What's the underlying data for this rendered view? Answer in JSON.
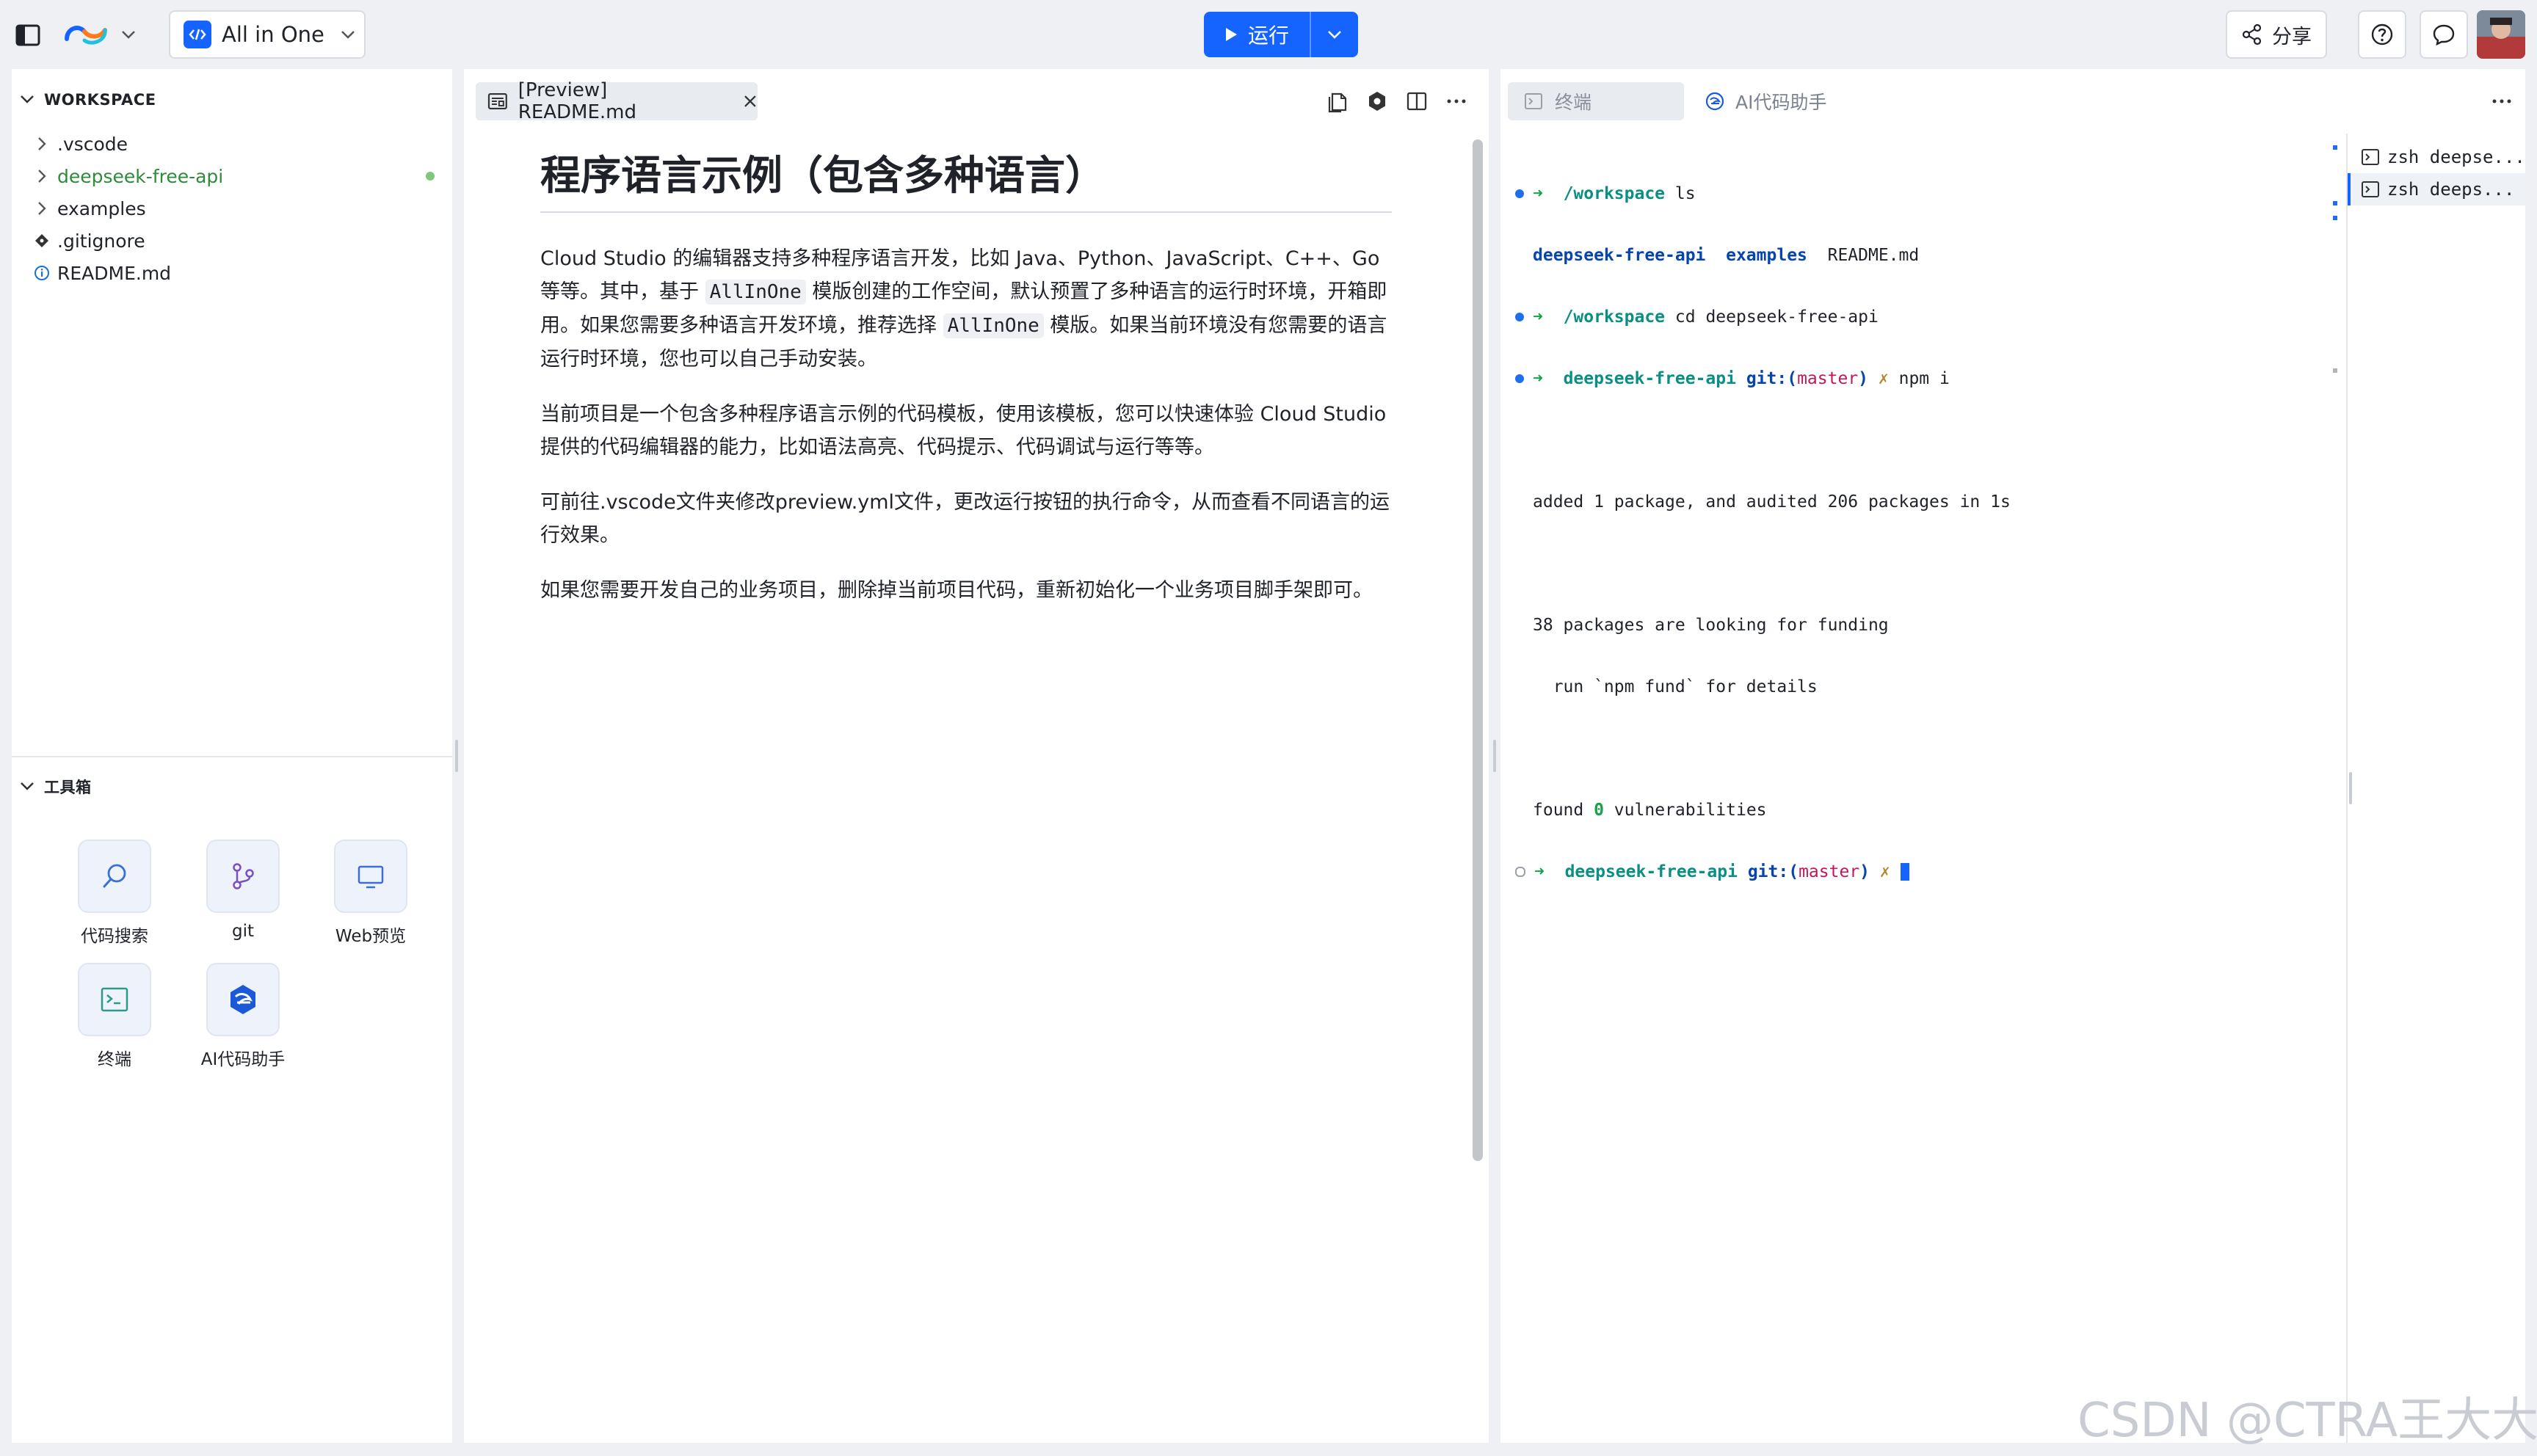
{
  "topbar": {
    "workspace_selector": "All in One",
    "run_label": "运行",
    "share_label": "分享"
  },
  "sidebar": {
    "workspace_title": "WORKSPACE",
    "items": [
      {
        "label": ".vscode",
        "type": "folder"
      },
      {
        "label": "deepseek-free-api",
        "type": "folder"
      },
      {
        "label": "examples",
        "type": "folder"
      },
      {
        "label": ".gitignore",
        "type": "file"
      },
      {
        "label": "README.md",
        "type": "file"
      }
    ],
    "toolbox_title": "工具箱",
    "tools": [
      {
        "label": "代码搜索",
        "icon": "search-icon"
      },
      {
        "label": "git",
        "icon": "git-branch-icon"
      },
      {
        "label": "Web预览",
        "icon": "monitor-icon"
      },
      {
        "label": "终端",
        "icon": "terminal-icon"
      },
      {
        "label": "AI代码助手",
        "icon": "ai-assistant-icon"
      }
    ]
  },
  "editor": {
    "tab_label": "[Preview] README.md",
    "heading": "程序语言示例（包含多种语言）",
    "p1_a": "Cloud Studio 的编辑器支持多种程序语言开发，比如 Java、Python、JavaScript、C++、Go 等等。其中，基于 ",
    "p1_code1": "AllInOne",
    "p1_b": " 模版创建的工作空间，默认预置了多种语言的运行时环境，开箱即用。如果您需要多种语言开发环境，推荐选择 ",
    "p1_code2": "AllInOne",
    "p1_c": " 模版。如果当前环境没有您需要的语言运行时环境，您也可以自己手动安装。",
    "p2": "当前项目是一个包含多种程序语言示例的代码模板，使用该模板，您可以快速体验 Cloud Studio 提供的代码编辑器的能力，比如语法高亮、代码提示、代码调试与运行等等。",
    "p3": "可前往.vscode文件夹修改preview.yml文件，更改运行按钮的执行命令，从而查看不同语言的运行效果。",
    "p4": "如果您需要开发自己的业务项目，删除掉当前项目代码，重新初始化一个业务项目脚手架即可。"
  },
  "terminal": {
    "tabs": [
      "终端",
      "AI代码助手"
    ],
    "l1_arrow": "➜",
    "l1_dir": "/workspace",
    "l1_cmd": "ls",
    "l2_a": "deepseek-free-api",
    "l2_b": "examples",
    "l2_c": "README.md",
    "l3_dir": "/workspace",
    "l3_cmd": "cd deepseek-free-api",
    "l4_dir": "deepseek-free-api",
    "l4_git": "git:(",
    "l4_branch": "master",
    "l4_git_end": ")",
    "l4_x": "✗",
    "l4_cmd": "npm i",
    "l5": "added 1 package, and audited 206 packages in 1s",
    "l6": "38 packages are looking for funding",
    "l7": "  run `npm fund` for details",
    "l8_a": "found ",
    "l8_num": "0",
    "l8_b": " vulnerabilities",
    "l9_dir": "deepseek-free-api",
    "l9_git": "git:(",
    "l9_branch": "master",
    "l9_git_end": ")",
    "l9_x": "✗",
    "list": [
      "zsh deepse...",
      "zsh deeps..."
    ]
  },
  "watermark": "CSDN @CTRA王大大"
}
